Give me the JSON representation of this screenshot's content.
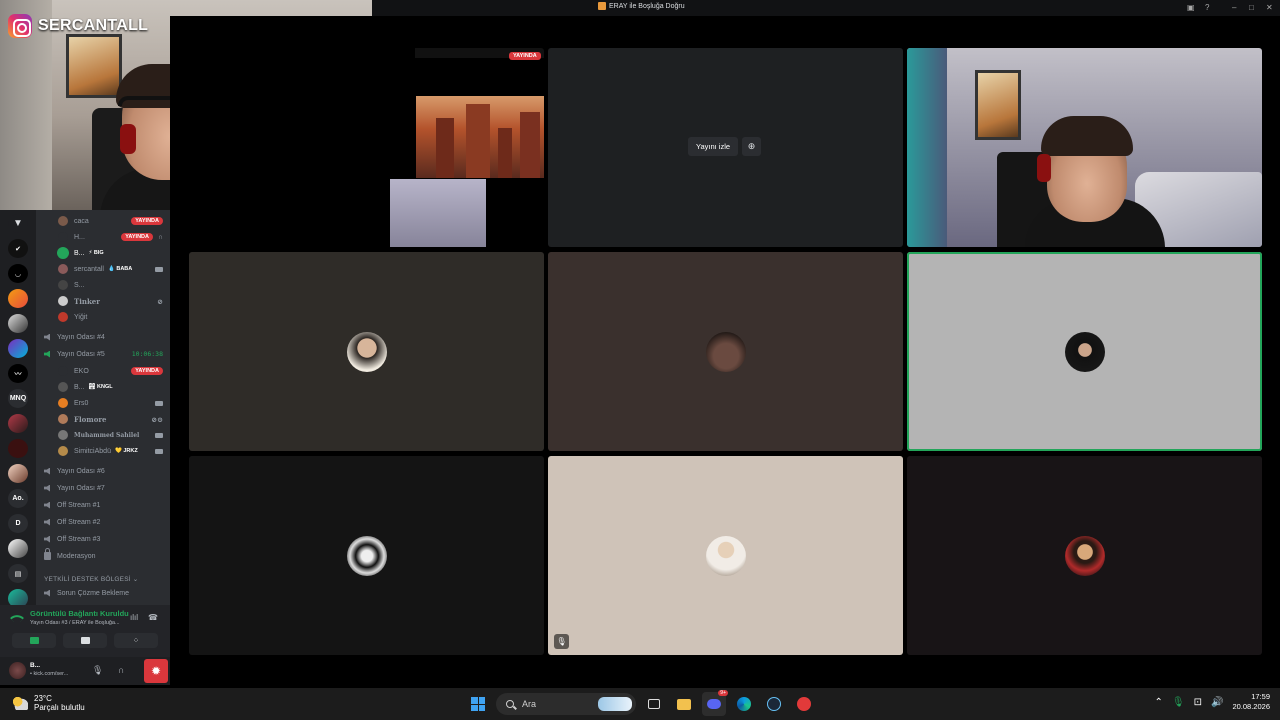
{
  "window": {
    "title": "ERAY ile Boşluğa Doğru"
  },
  "overlay": {
    "brand": "SERCANTALL"
  },
  "channels": {
    "users_room3": [
      {
        "name": "caca",
        "badge": "YAYINDA"
      },
      {
        "name": "H...",
        "badge": "YAYINDA"
      },
      {
        "name": "B...",
        "tag": "BIG"
      },
      {
        "name": "sercantall",
        "tag": "BABA"
      },
      {
        "name": "S..."
      },
      {
        "name": "Tinker"
      },
      {
        "name": "Yiğit"
      }
    ],
    "room4": "Yayın Odası #4",
    "room5": "Yayın Odası #5",
    "room5_timer": "10:06:38",
    "users_room5": [
      {
        "name": "EKO",
        "badge": "YAYINDA"
      },
      {
        "name": "B...",
        "tag": "KNGL"
      },
      {
        "name": "Ers0"
      },
      {
        "name": "Flomore"
      },
      {
        "name": "Muhammed Sahilel"
      },
      {
        "name": "SimitciAbdü",
        "tag": "JRKZ"
      }
    ],
    "room6": "Yayın Odası #6",
    "room7": "Yayın Odası #7",
    "off1": "Off Stream #1",
    "off2": "Off Stream #2",
    "off3": "Off Stream #3",
    "moderation": "Moderasyon",
    "category": "YETKİLİ DESTEK BÖLGESİ",
    "support": "Sorun Çözme Bekleme"
  },
  "voice": {
    "status": "Görüntülü Bağlantı Kuruldu",
    "location": "Yayın Odası #3 / ERAY ile Boşluğa..."
  },
  "user_panel": {
    "name": "B...",
    "status": "• kick.com/ser..."
  },
  "rail": {
    "labels": [
      "MNQ",
      "Ao.",
      "D"
    ]
  },
  "stage": {
    "live_badge": "YAYINDA",
    "watch_label": "Yayını izle"
  },
  "taskbar": {
    "temp": "23°C",
    "weather": "Parçalı bulutlu",
    "search": "Ara",
    "discord_badge": "9+",
    "time": "17:59",
    "date": "20.08.2026"
  },
  "colors": {
    "live": "#da373c",
    "online": "#23a55a",
    "sidebar": "#2b2d31"
  }
}
